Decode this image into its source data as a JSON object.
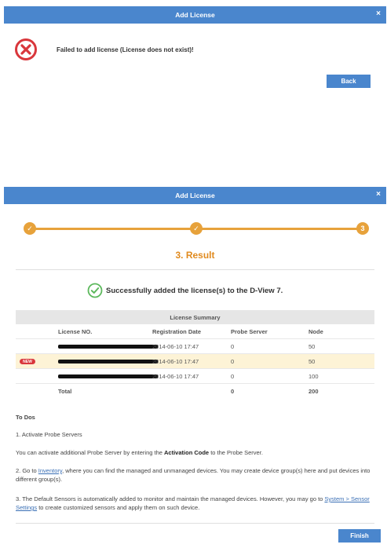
{
  "dialog1": {
    "title": "Add License",
    "close": "×",
    "message": "Failed to add license (License does not exist)!",
    "back_label": "Back",
    "icon": "error-x-circle-icon",
    "colors": {
      "title_bar": "#4a86cd",
      "error": "#d9373c"
    }
  },
  "dialog2": {
    "title": "Add License",
    "close": "×",
    "steps": [
      {
        "symbol": "✓"
      },
      {
        "symbol": "✓"
      },
      {
        "symbol": "3"
      }
    ],
    "step_title": "3. Result",
    "success_message": "Successfully added the license(s) to the D-View 7.",
    "summary": {
      "title": "License Summary",
      "columns": [
        "License NO.",
        "Registration Date",
        "Probe Server",
        "Node"
      ],
      "rows": [
        {
          "license": "[redacted]",
          "date": "2014-06-10 17:47",
          "probe": "0",
          "node": "50",
          "badge": ""
        },
        {
          "license": "[redacted]",
          "date": "2014-06-10 17:47",
          "probe": "0",
          "node": "50",
          "badge": "NEW"
        },
        {
          "license": "[redacted]",
          "date": "2014-06-10 17:47",
          "probe": "0",
          "node": "100",
          "badge": ""
        }
      ],
      "total": {
        "label": "Total",
        "probe": "0",
        "node": "200"
      }
    },
    "todos": {
      "heading": "To Dos",
      "item1_title": "1. Activate Probe Servers",
      "item1_pre": "You can activate additional Probe Server by entering the ",
      "item1_bold": "Activation Code",
      "item1_post": " to the Probe Server.",
      "item2_pre": "2. Go to ",
      "item2_link": "Inventory",
      "item2_post": ", where you can find the managed and unmanaged devices. You may create device group(s) here and put devices into different group(s).",
      "item3_pre": "3. The Default Sensors is automatically added to monitor and maintain the managed devices. However, you may go to ",
      "item3_link": "System > Sensor Settings",
      "item3_post": " to create customized sensors and apply them on such device."
    },
    "finish_label": "Finish",
    "colors": {
      "accent": "#e7a23b",
      "step_title": "#e08a1e",
      "success": "#5cb85c",
      "highlight_row": "#fdf3d6"
    }
  }
}
